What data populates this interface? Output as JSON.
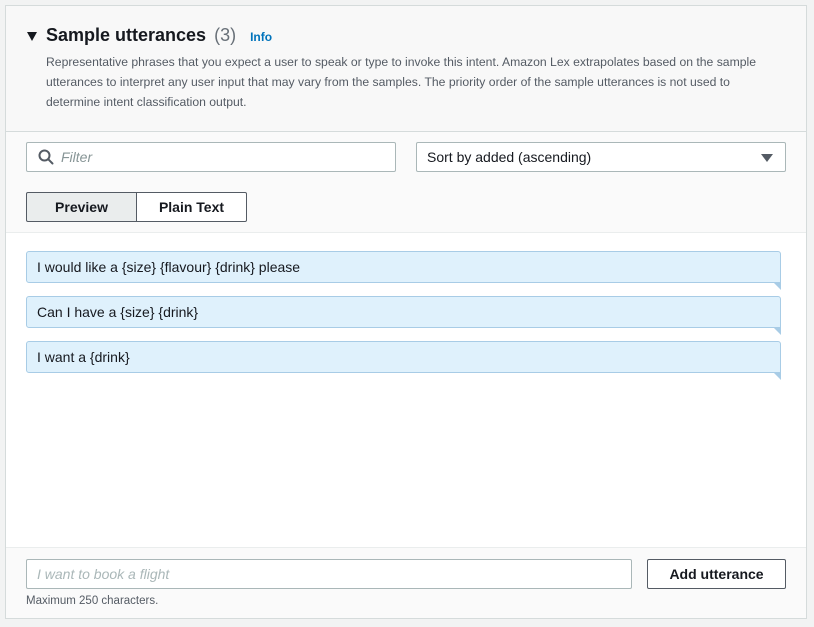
{
  "section": {
    "title": "Sample utterances",
    "count": "(3)",
    "info_link": "Info",
    "description": "Representative phrases that you expect a user to speak or type to invoke this intent. Amazon Lex extrapolates based on the sample utterances to interpret any user input that may vary from the samples. The priority order of the sample utterances is not used to determine intent classification output."
  },
  "controls": {
    "filter_placeholder": "Filter",
    "sort_selected": "Sort by added (ascending)",
    "toggle_preview": "Preview",
    "toggle_plain_text": "Plain Text",
    "active_toggle": "Preview"
  },
  "utterances": [
    "I would like a {size} {flavour} {drink} please",
    "Can I have a {size} {drink}",
    "I want a {drink}"
  ],
  "footer": {
    "input_placeholder": "I want to book a flight",
    "add_button": "Add utterance",
    "hint": "Maximum 250 characters."
  },
  "icons": {
    "expand": "caret-down-icon",
    "search": "search-icon",
    "dropdown": "chevron-down-icon"
  },
  "colors": {
    "link": "#0073bb",
    "bubble_bg": "#dff1fc",
    "bubble_border": "#a8cce6"
  }
}
